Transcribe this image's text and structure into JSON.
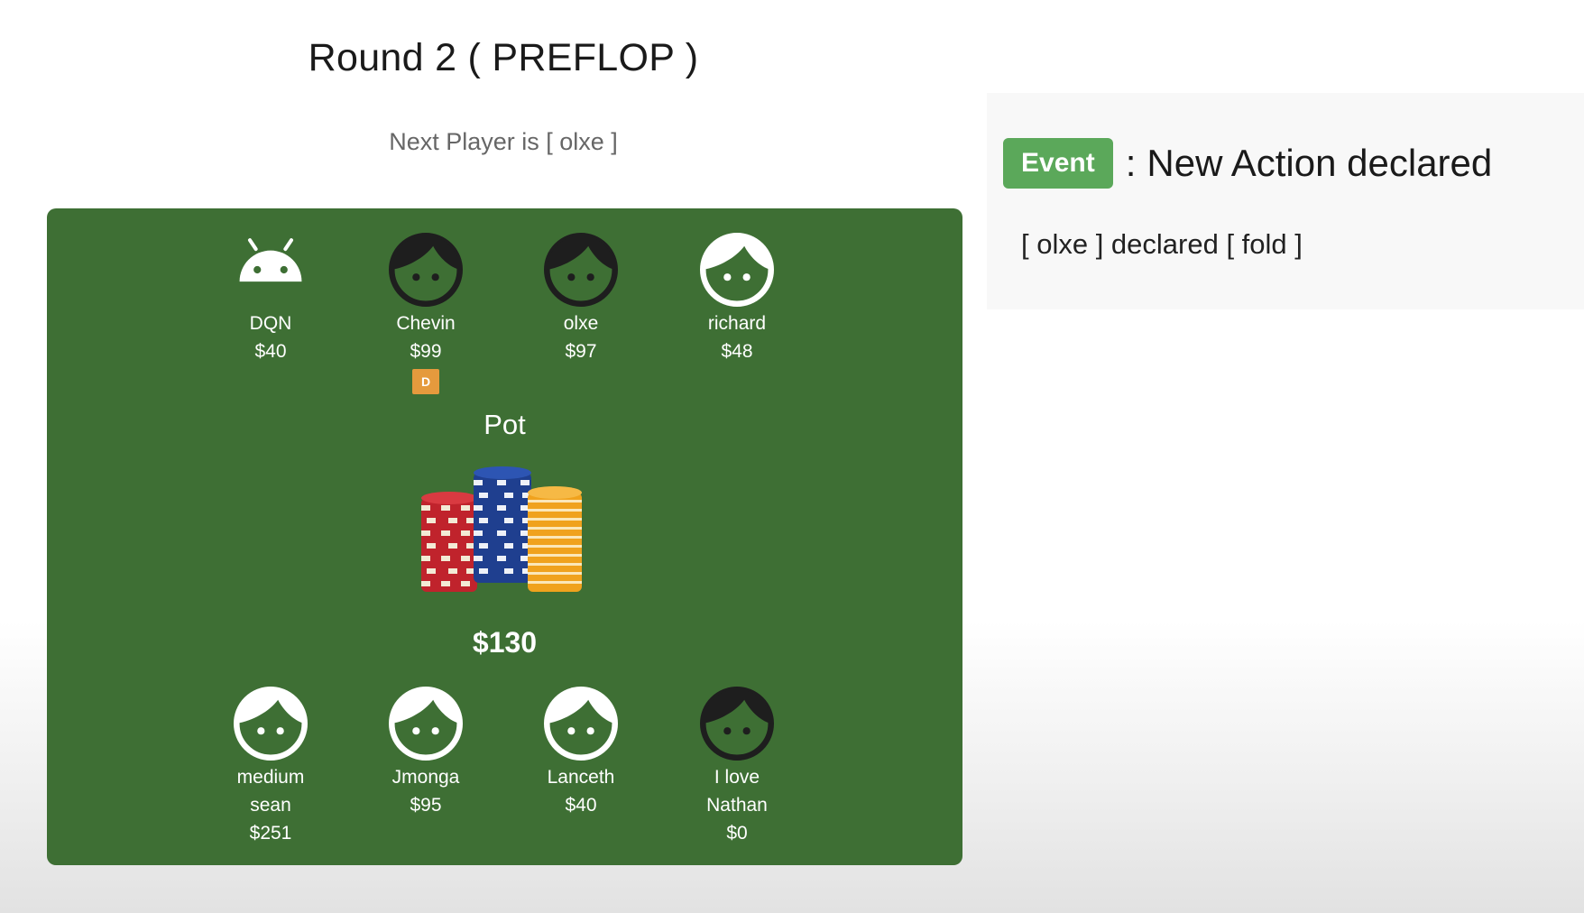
{
  "round": {
    "title": "Round 2 ( PREFLOP )"
  },
  "next_player": {
    "text": "Next Player is [ olxe ]"
  },
  "table": {
    "color": "#3e6f34",
    "players_top": [
      {
        "name": "DQN",
        "money": "$40",
        "avatar": "android-icon"
      },
      {
        "name": "Chevin",
        "money": "$99",
        "avatar": "dark-face-icon",
        "dealer": "D"
      },
      {
        "name": "olxe",
        "money": "$97",
        "avatar": "dark-face-icon"
      },
      {
        "name": "richard",
        "money": "$48",
        "avatar": "light-face-icon"
      }
    ],
    "pot": {
      "label": "Pot",
      "amount": "$130",
      "icon": "poker-chips-icon"
    },
    "players_bottom": [
      {
        "name_line1": "medium",
        "name_line2": "sean",
        "money": "$251",
        "avatar": "light-face-icon"
      },
      {
        "name_line1": "Jmonga",
        "money": "$95",
        "avatar": "light-face-icon"
      },
      {
        "name_line1": "Lanceth",
        "money": "$40",
        "avatar": "light-face-icon"
      },
      {
        "name_line1": "I love",
        "name_line2": "Nathan",
        "money": "$0",
        "avatar": "dark-face-icon"
      }
    ]
  },
  "event": {
    "badge": "Event",
    "colon": ":",
    "title": "New Action declared",
    "message": "[ olxe ] declared [ fold ]",
    "badge_color": "#5ba85a"
  }
}
